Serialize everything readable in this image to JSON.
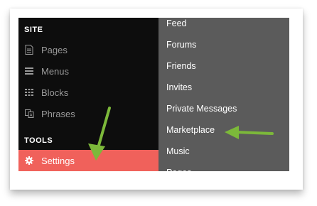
{
  "sidebar": {
    "site_title": "SITE",
    "tools_title": "TOOLS",
    "items": [
      {
        "label": "Pages",
        "icon": "page-icon"
      },
      {
        "label": "Menus",
        "icon": "menu-lines-icon"
      },
      {
        "label": "Blocks",
        "icon": "grid-icon"
      },
      {
        "label": "Phrases",
        "icon": "phrases-icon"
      }
    ],
    "settings": {
      "label": "Settings",
      "icon": "gear-icon"
    }
  },
  "menu": {
    "items": [
      "Feed",
      "Forums",
      "Friends",
      "Invites",
      "Private Messages",
      "Marketplace",
      "Music",
      "Pages"
    ]
  },
  "colors": {
    "sidebar_bg": "#0d0d0d",
    "menu_bg": "#5b5b5b",
    "active_item": "#f0615b",
    "annotation_arrow": "#7cb83a"
  }
}
